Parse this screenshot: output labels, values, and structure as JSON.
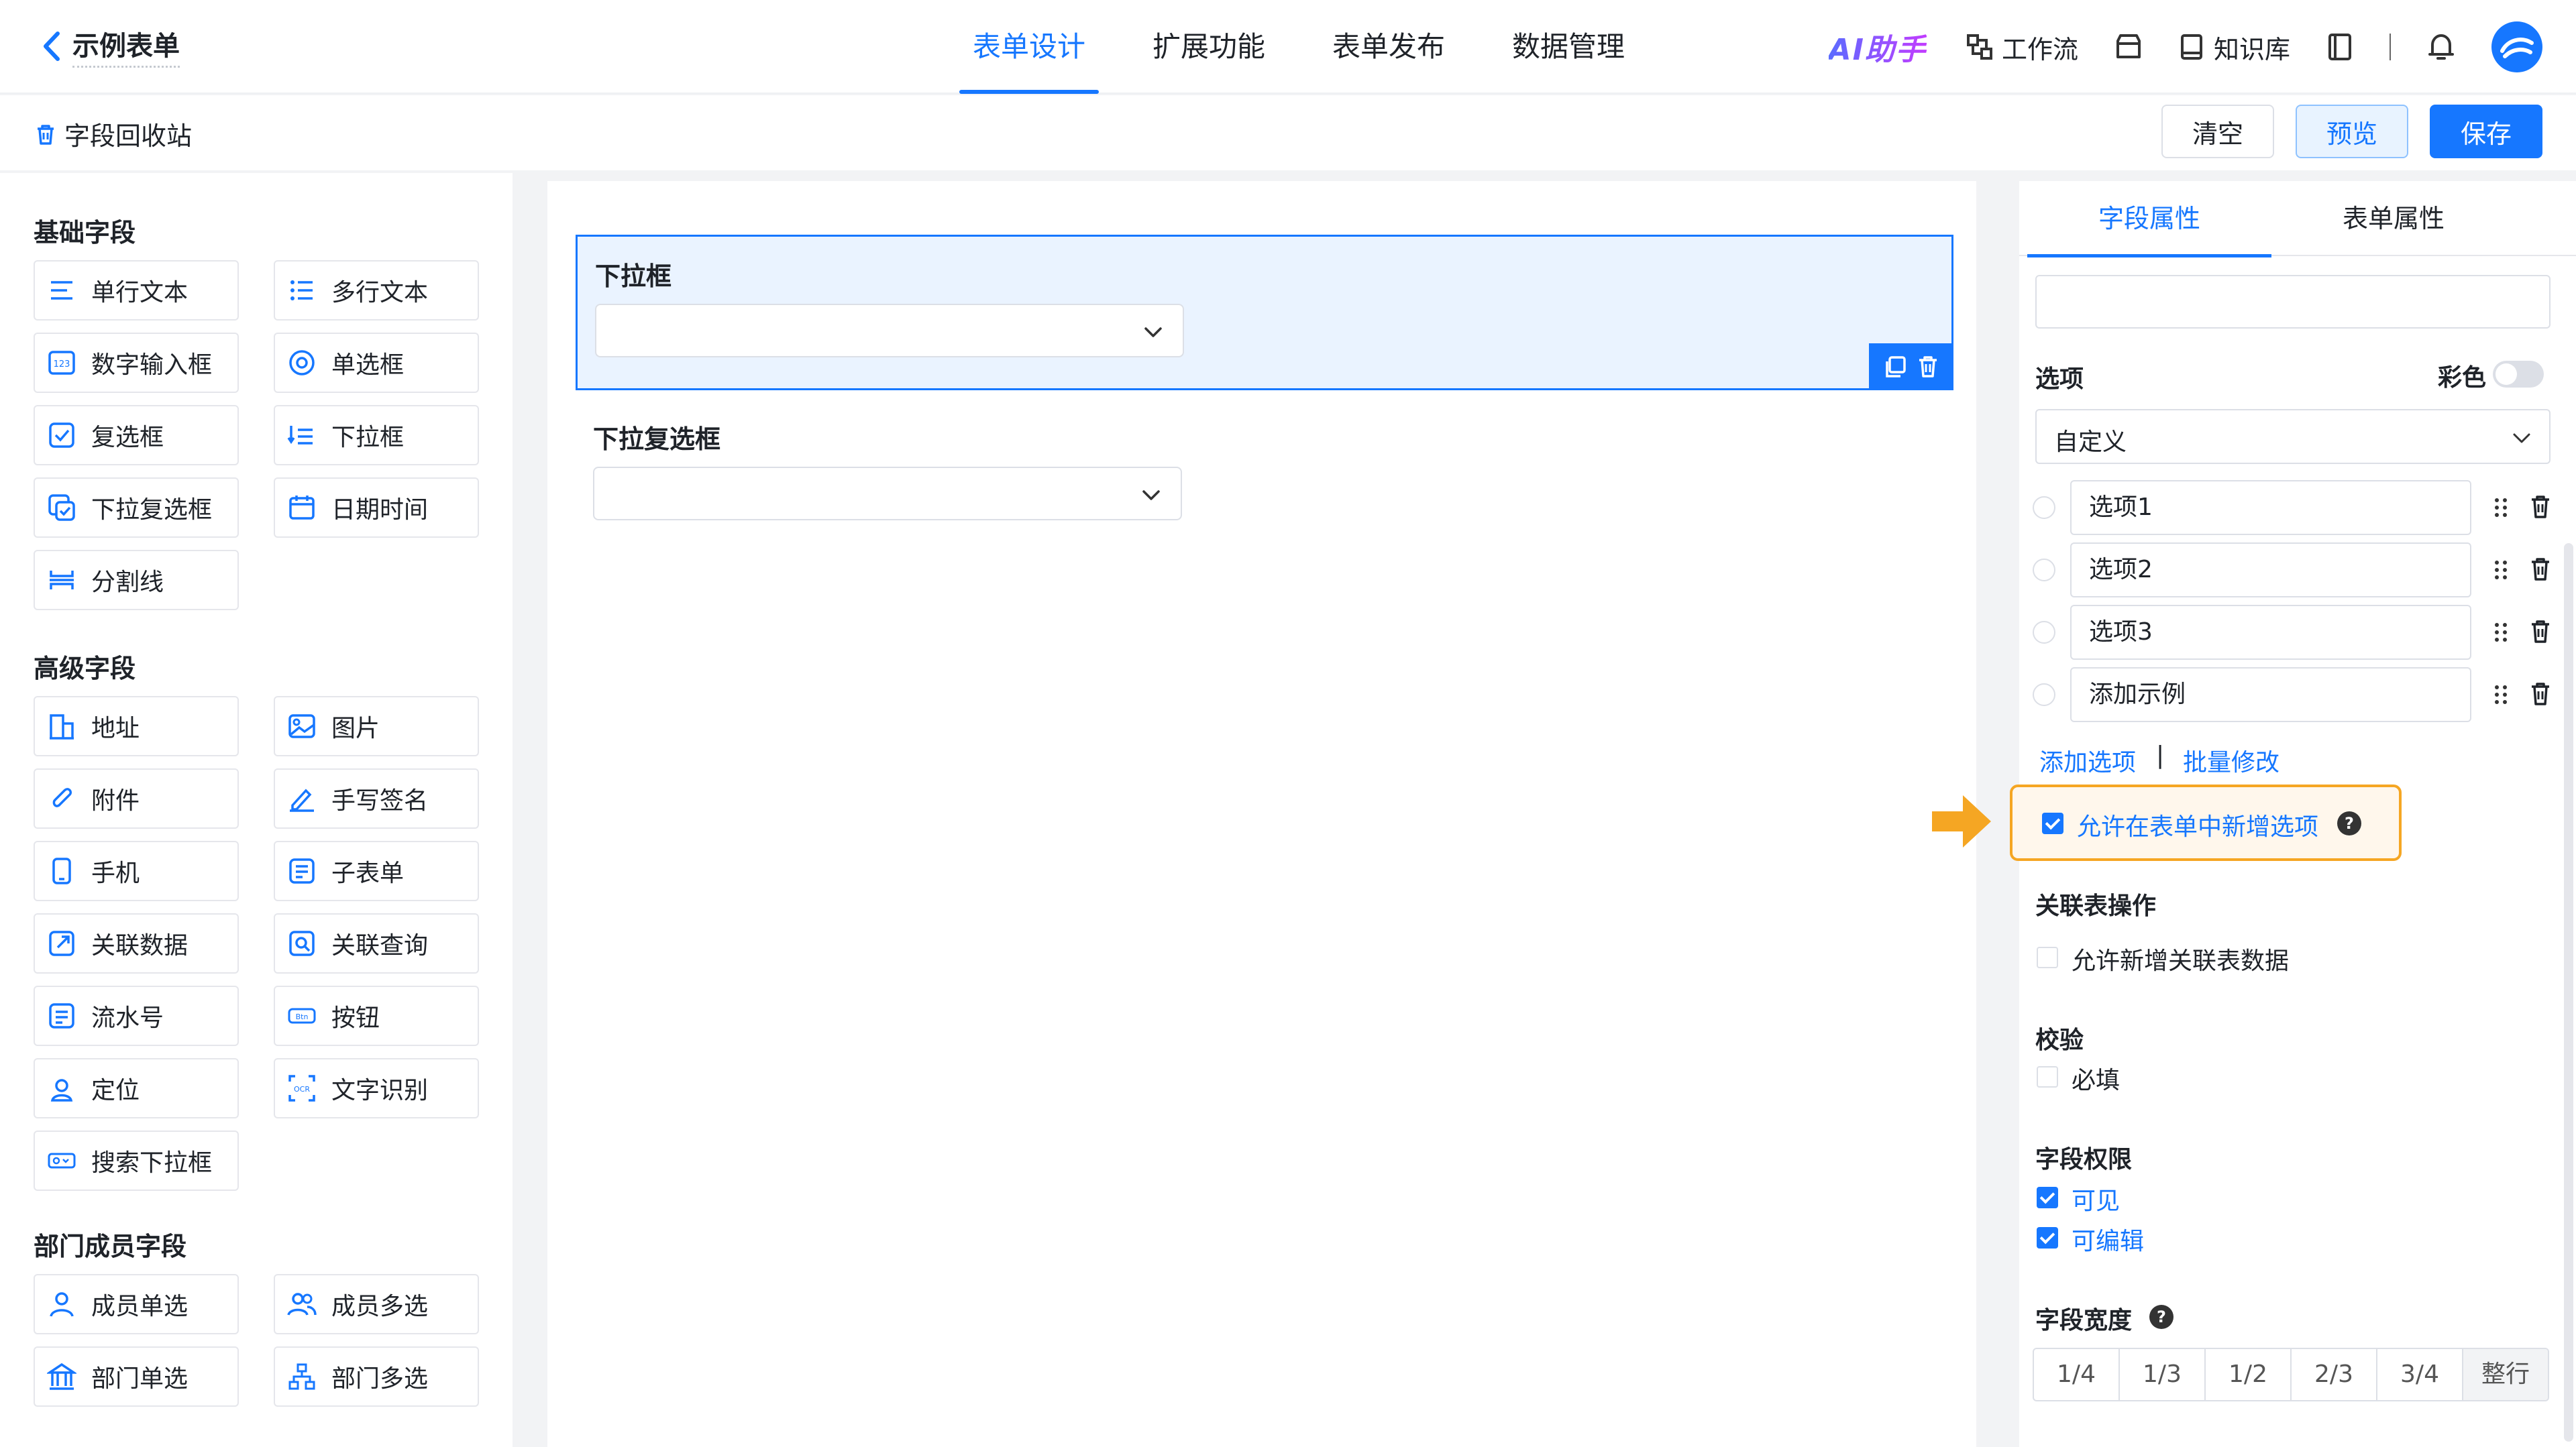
{
  "header": {
    "back_title": "示例表单",
    "tabs": [
      "表单设计",
      "扩展功能",
      "表单发布",
      "数据管理"
    ],
    "active_tab": 0,
    "ai_label": "AI助手",
    "workflow": "工作流",
    "knowledge": "知识库"
  },
  "subbar": {
    "recycle": "字段回收站",
    "clear": "清空",
    "preview": "预览",
    "save": "保存"
  },
  "left": {
    "sections": [
      {
        "title": "基础字段",
        "items": [
          {
            "label": "单行文本",
            "icon": "single-line-text-icon"
          },
          {
            "label": "多行文本",
            "icon": "multi-line-text-icon"
          },
          {
            "label": "数字输入框",
            "icon": "number-input-icon"
          },
          {
            "label": "单选框",
            "icon": "radio-icon"
          },
          {
            "label": "复选框",
            "icon": "checkbox-icon"
          },
          {
            "label": "下拉框",
            "icon": "dropdown-icon"
          },
          {
            "label": "下拉复选框",
            "icon": "dropdown-checkbox-icon"
          },
          {
            "label": "日期时间",
            "icon": "calendar-icon"
          },
          {
            "label": "分割线",
            "icon": "divider-icon"
          }
        ]
      },
      {
        "title": "高级字段",
        "items": [
          {
            "label": "地址",
            "icon": "address-icon"
          },
          {
            "label": "图片",
            "icon": "image-icon"
          },
          {
            "label": "附件",
            "icon": "attachment-icon"
          },
          {
            "label": "手写签名",
            "icon": "signature-icon"
          },
          {
            "label": "手机",
            "icon": "phone-icon"
          },
          {
            "label": "子表单",
            "icon": "subform-icon"
          },
          {
            "label": "关联数据",
            "icon": "linked-data-icon"
          },
          {
            "label": "关联查询",
            "icon": "linked-query-icon"
          },
          {
            "label": "流水号",
            "icon": "serial-number-icon"
          },
          {
            "label": "按钮",
            "icon": "button-icon"
          },
          {
            "label": "定位",
            "icon": "location-icon"
          },
          {
            "label": "文字识别",
            "icon": "ocr-icon"
          },
          {
            "label": "搜索下拉框",
            "icon": "search-dropdown-icon"
          }
        ]
      },
      {
        "title": "部门成员字段",
        "items": [
          {
            "label": "成员单选",
            "icon": "member-single-icon"
          },
          {
            "label": "成员多选",
            "icon": "member-multi-icon"
          },
          {
            "label": "部门单选",
            "icon": "department-single-icon"
          },
          {
            "label": "部门多选",
            "icon": "department-multi-icon"
          }
        ]
      }
    ]
  },
  "canvas": {
    "fields": [
      {
        "label": "下拉框",
        "selected": true
      },
      {
        "label": "下拉复选框",
        "selected": false
      }
    ]
  },
  "right": {
    "tabs": [
      "字段属性",
      "表单属性"
    ],
    "options_label": "选项",
    "colorful_label": "彩色",
    "source_value": "自定义",
    "options": [
      "选项1",
      "选项2",
      "选项3",
      "添加示例"
    ],
    "add_option": "添加选项",
    "divider": "|",
    "batch_edit": "批量修改",
    "allow_new_option": "允许在表单中新增选项",
    "help_mark": "?",
    "linked_table_label": "关联表操作",
    "allow_new_linked": "允许新增关联表数据",
    "validation_label": "校验",
    "required": "必填",
    "permission_label": "字段权限",
    "visible": "可见",
    "editable": "可编辑",
    "width_label": "字段宽度",
    "widths": [
      "1/4",
      "1/3",
      "1/2",
      "2/3",
      "3/4",
      "整行"
    ]
  },
  "colors": {
    "accent": "#1677ff",
    "highlight": "#f5a623"
  }
}
